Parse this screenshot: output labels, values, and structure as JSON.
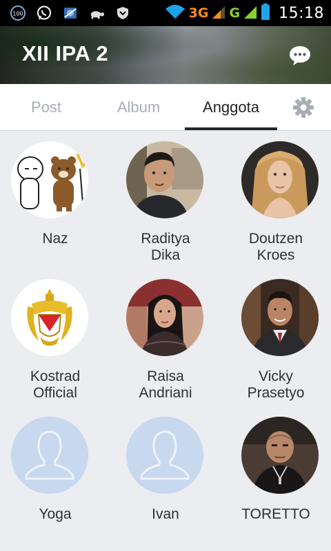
{
  "status_bar": {
    "left_icons": [
      "badge-100-icon",
      "whatsapp-icon",
      "browser-icon",
      "turtle-icon",
      "shield-icon"
    ],
    "network_3g": "3G",
    "network_g": "G",
    "time": "15:18"
  },
  "header": {
    "title": "XII IPA 2",
    "chat_icon": "chat-bubble-icon"
  },
  "tabs": [
    {
      "label": "Post",
      "active": false
    },
    {
      "label": "Album",
      "active": false
    },
    {
      "label": "Anggota",
      "active": true
    }
  ],
  "settings_icon": "gear-icon",
  "members": [
    {
      "name": "Naz",
      "avatar": "cartoon-characters"
    },
    {
      "name": "Raditya\nDika",
      "avatar": "photo"
    },
    {
      "name": "Doutzen\nKroes",
      "avatar": "photo"
    },
    {
      "name": "Kostrad\nOfficial",
      "avatar": "emblem"
    },
    {
      "name": "Raisa\nAndriani",
      "avatar": "photo"
    },
    {
      "name": "Vicky\nPrasetyo",
      "avatar": "photo"
    },
    {
      "name": "Yoga",
      "avatar": "default-silhouette"
    },
    {
      "name": "Ivan",
      "avatar": "default-silhouette"
    },
    {
      "name": "TORETTO",
      "avatar": "photo"
    }
  ],
  "colors": {
    "background": "#ebedf0",
    "active_tab_text": "#1f2226",
    "inactive_tab_text": "#a9adb5",
    "default_avatar_bg": "#c7d8ef"
  }
}
